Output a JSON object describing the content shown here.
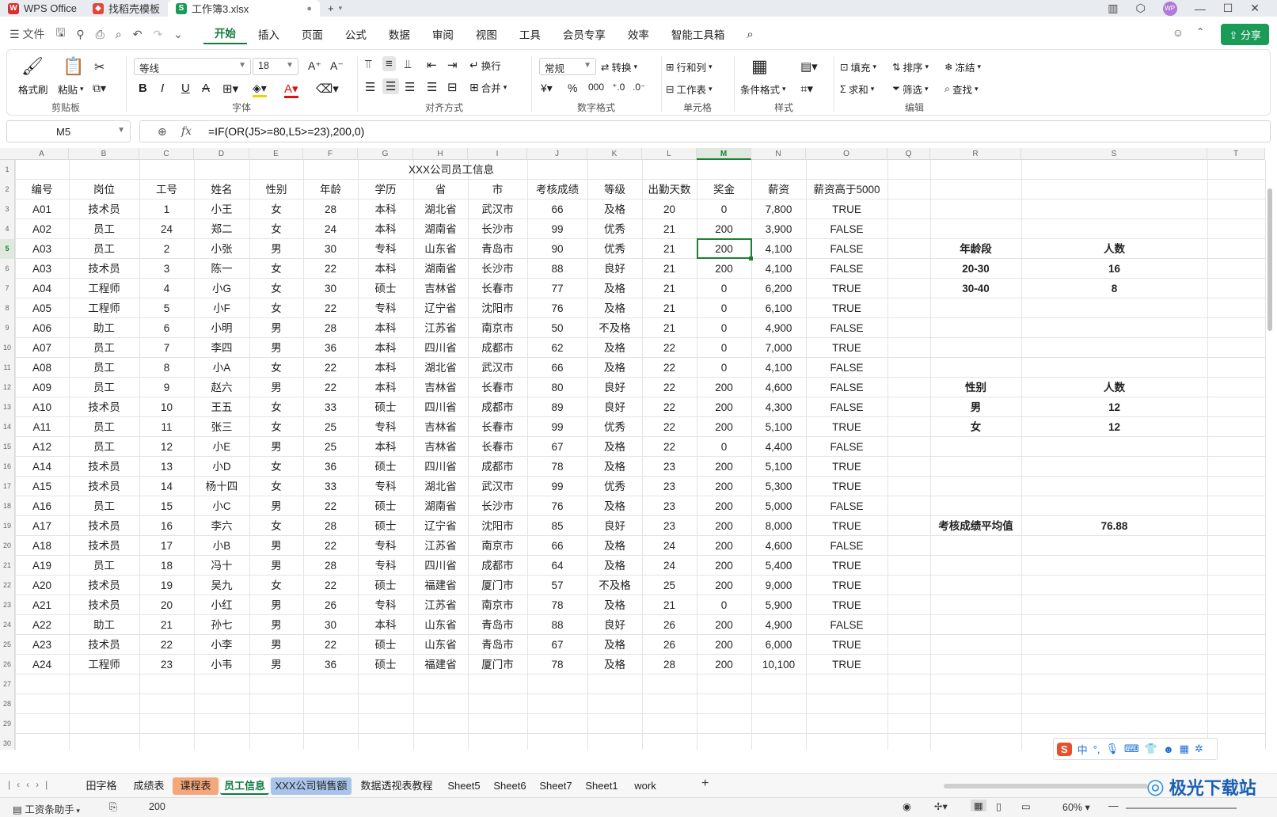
{
  "titlebar": {
    "tabs": [
      {
        "label": "WPS Office",
        "icon": "wps-logo-icon"
      },
      {
        "label": "找稻壳模板",
        "icon": "docer-logo-icon"
      },
      {
        "label": "工作簿3.xlsx",
        "icon": "sheet-logo-icon"
      }
    ],
    "new_tab": "+"
  },
  "menubar": {
    "file_label": "文件",
    "items": [
      "开始",
      "插入",
      "页面",
      "公式",
      "数据",
      "审阅",
      "视图",
      "工具",
      "会员专享",
      "效率",
      "智能工具箱"
    ],
    "active": "开始",
    "share_label": "分享"
  },
  "ribbon": {
    "clipboard": {
      "format_painter": "格式刷",
      "paste": "粘贴",
      "label": "剪贴板"
    },
    "font": {
      "name": "等线",
      "size": "18",
      "label": "字体"
    },
    "align": {
      "wrap": "换行",
      "merge": "合并",
      "label": "对齐方式"
    },
    "number": {
      "format": "常规",
      "convert": "转换",
      "label": "数字格式"
    },
    "cells": {
      "rowcol": "行和列",
      "sheet": "工作表",
      "label": "单元格"
    },
    "style": {
      "cond": "条件格式",
      "label": "样式"
    },
    "edit": {
      "fill": "填充",
      "sort": "排序",
      "freeze": "冻结",
      "sum": "求和",
      "filter": "筛选",
      "find": "查找",
      "label": "编辑"
    }
  },
  "formula_bar": {
    "name_box": "M5",
    "fx": "fx",
    "formula": "=IF(OR(J5>=80,L5>=23),200,0)"
  },
  "columns": [
    "A",
    "B",
    "C",
    "D",
    "E",
    "F",
    "G",
    "H",
    "I",
    "J",
    "K",
    "L",
    "M",
    "N",
    "O",
    "Q",
    "R",
    "S",
    "T"
  ],
  "sheet": {
    "title": "XXX公司员工信息",
    "headers": [
      "编号",
      "岗位",
      "工号",
      "姓名",
      "性别",
      "年龄",
      "学历",
      "省",
      "市",
      "考核成绩",
      "等级",
      "出勤天数",
      "奖金",
      "薪资",
      "薪资高于5000"
    ],
    "rows": [
      [
        "A01",
        "技术员",
        "1",
        "小王",
        "女",
        "28",
        "本科",
        "湖北省",
        "武汉市",
        "66",
        "及格",
        "20",
        "0",
        "7,800",
        "TRUE"
      ],
      [
        "A02",
        "员工",
        "24",
        "郑二",
        "女",
        "24",
        "本科",
        "湖南省",
        "长沙市",
        "99",
        "优秀",
        "21",
        "200",
        "3,900",
        "FALSE"
      ],
      [
        "A03",
        "员工",
        "2",
        "小张",
        "男",
        "30",
        "专科",
        "山东省",
        "青岛市",
        "90",
        "优秀",
        "21",
        "200",
        "4,100",
        "FALSE"
      ],
      [
        "A03",
        "技术员",
        "3",
        "陈一",
        "女",
        "22",
        "本科",
        "湖南省",
        "长沙市",
        "88",
        "良好",
        "21",
        "200",
        "4,100",
        "FALSE"
      ],
      [
        "A04",
        "工程师",
        "4",
        "小G",
        "女",
        "30",
        "硕士",
        "吉林省",
        "长春市",
        "77",
        "及格",
        "21",
        "0",
        "6,200",
        "TRUE"
      ],
      [
        "A05",
        "工程师",
        "5",
        "小F",
        "女",
        "22",
        "专科",
        "辽宁省",
        "沈阳市",
        "76",
        "及格",
        "21",
        "0",
        "6,100",
        "TRUE"
      ],
      [
        "A06",
        "助工",
        "6",
        "小明",
        "男",
        "28",
        "本科",
        "江苏省",
        "南京市",
        "50",
        "不及格",
        "21",
        "0",
        "4,900",
        "FALSE"
      ],
      [
        "A07",
        "员工",
        "7",
        "李四",
        "男",
        "36",
        "本科",
        "四川省",
        "成都市",
        "62",
        "及格",
        "22",
        "0",
        "7,000",
        "TRUE"
      ],
      [
        "A08",
        "员工",
        "8",
        "小A",
        "女",
        "22",
        "本科",
        "湖北省",
        "武汉市",
        "66",
        "及格",
        "22",
        "0",
        "4,100",
        "FALSE"
      ],
      [
        "A09",
        "员工",
        "9",
        "赵六",
        "男",
        "22",
        "本科",
        "吉林省",
        "长春市",
        "80",
        "良好",
        "22",
        "200",
        "4,600",
        "FALSE"
      ],
      [
        "A10",
        "技术员",
        "10",
        "王五",
        "女",
        "33",
        "硕士",
        "四川省",
        "成都市",
        "89",
        "良好",
        "22",
        "200",
        "4,300",
        "FALSE"
      ],
      [
        "A11",
        "员工",
        "11",
        "张三",
        "女",
        "25",
        "专科",
        "吉林省",
        "长春市",
        "99",
        "优秀",
        "22",
        "200",
        "5,100",
        "TRUE"
      ],
      [
        "A12",
        "员工",
        "12",
        "小E",
        "男",
        "25",
        "本科",
        "吉林省",
        "长春市",
        "67",
        "及格",
        "22",
        "0",
        "4,400",
        "FALSE"
      ],
      [
        "A14",
        "技术员",
        "13",
        "小D",
        "女",
        "36",
        "硕士",
        "四川省",
        "成都市",
        "78",
        "及格",
        "23",
        "200",
        "5,100",
        "TRUE"
      ],
      [
        "A15",
        "技术员",
        "14",
        "杨十四",
        "女",
        "33",
        "专科",
        "湖北省",
        "武汉市",
        "99",
        "优秀",
        "23",
        "200",
        "5,300",
        "TRUE"
      ],
      [
        "A16",
        "员工",
        "15",
        "小C",
        "男",
        "22",
        "硕士",
        "湖南省",
        "长沙市",
        "76",
        "及格",
        "23",
        "200",
        "5,000",
        "FALSE"
      ],
      [
        "A17",
        "技术员",
        "16",
        "李六",
        "女",
        "28",
        "硕士",
        "辽宁省",
        "沈阳市",
        "85",
        "良好",
        "23",
        "200",
        "8,000",
        "TRUE"
      ],
      [
        "A18",
        "技术员",
        "17",
        "小B",
        "男",
        "22",
        "专科",
        "江苏省",
        "南京市",
        "66",
        "及格",
        "24",
        "200",
        "4,600",
        "FALSE"
      ],
      [
        "A19",
        "员工",
        "18",
        "冯十",
        "男",
        "28",
        "专科",
        "四川省",
        "成都市",
        "64",
        "及格",
        "24",
        "200",
        "5,400",
        "TRUE"
      ],
      [
        "A20",
        "技术员",
        "19",
        "吴九",
        "女",
        "22",
        "硕士",
        "福建省",
        "厦门市",
        "57",
        "不及格",
        "25",
        "200",
        "9,000",
        "TRUE"
      ],
      [
        "A21",
        "技术员",
        "20",
        "小红",
        "男",
        "26",
        "专科",
        "江苏省",
        "南京市",
        "78",
        "及格",
        "21",
        "0",
        "5,900",
        "TRUE"
      ],
      [
        "A22",
        "助工",
        "21",
        "孙七",
        "男",
        "30",
        "本科",
        "山东省",
        "青岛市",
        "88",
        "良好",
        "26",
        "200",
        "4,900",
        "FALSE"
      ],
      [
        "A23",
        "技术员",
        "22",
        "小李",
        "男",
        "22",
        "硕士",
        "山东省",
        "青岛市",
        "67",
        "及格",
        "26",
        "200",
        "6,000",
        "TRUE"
      ],
      [
        "A24",
        "工程师",
        "23",
        "小韦",
        "男",
        "36",
        "硕士",
        "福建省",
        "厦门市",
        "78",
        "及格",
        "28",
        "200",
        "10,100",
        "TRUE"
      ]
    ],
    "side": {
      "age_header": [
        "年龄段",
        "人数"
      ],
      "age_rows": [
        [
          "20-30",
          "16"
        ],
        [
          "30-40",
          "8"
        ]
      ],
      "gender_header": [
        "性别",
        "人数"
      ],
      "gender_rows": [
        [
          "男",
          "12"
        ],
        [
          "女",
          "12"
        ]
      ],
      "avg_label": "考核成绩平均值",
      "avg_value": "76.88"
    }
  },
  "sheet_tabs": [
    "田字格",
    "成绩表",
    "课程表",
    "员工信息",
    "XXX公司销售额",
    "数据透视表教程",
    "Sheet5",
    "Sheet6",
    "Sheet7",
    "Sheet1",
    "work"
  ],
  "active_sheet": "员工信息",
  "status": {
    "helper": "工资条助手",
    "value": "200",
    "zoom": "60%"
  },
  "watermark": "极光下载站",
  "colors": {
    "accent": "#0f7b3f",
    "selection": "#1e7e34",
    "tab_orange": "#f4a77a",
    "tab_blue": "#a9c4ea",
    "tab_active": "#ffffff"
  }
}
